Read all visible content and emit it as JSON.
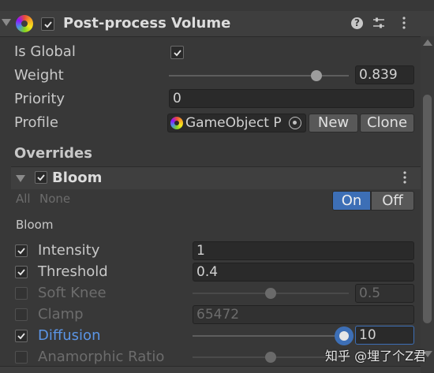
{
  "component": {
    "title": "Post-process Volume"
  },
  "volume": {
    "is_global_label": "Is Global",
    "weight_label": "Weight",
    "weight_value": "0.839",
    "priority_label": "Priority",
    "priority_value": "0",
    "profile_label": "Profile",
    "profile_value": "GameObject P",
    "new_label": "New",
    "clone_label": "Clone"
  },
  "overrides_label": "Overrides",
  "bloom": {
    "header_title": "Bloom",
    "all_label": "All",
    "none_label": "None",
    "on_label": "On",
    "off_label": "Off",
    "section_label": "Bloom",
    "intensity_label": "Intensity",
    "intensity_value": "1",
    "threshold_label": "Threshold",
    "threshold_value": "0.4",
    "soft_knee_label": "Soft Knee",
    "soft_knee_value": "0.5",
    "clamp_label": "Clamp",
    "clamp_value": "65472",
    "diffusion_label": "Diffusion",
    "diffusion_value": "10",
    "anamorphic_label": "Anamorphic Ratio"
  },
  "watermark": "知乎 @埋了个Z君",
  "colors": {
    "accent": "#3d6fb6",
    "highlight_label": "#5b95e6",
    "background": "#383838"
  }
}
